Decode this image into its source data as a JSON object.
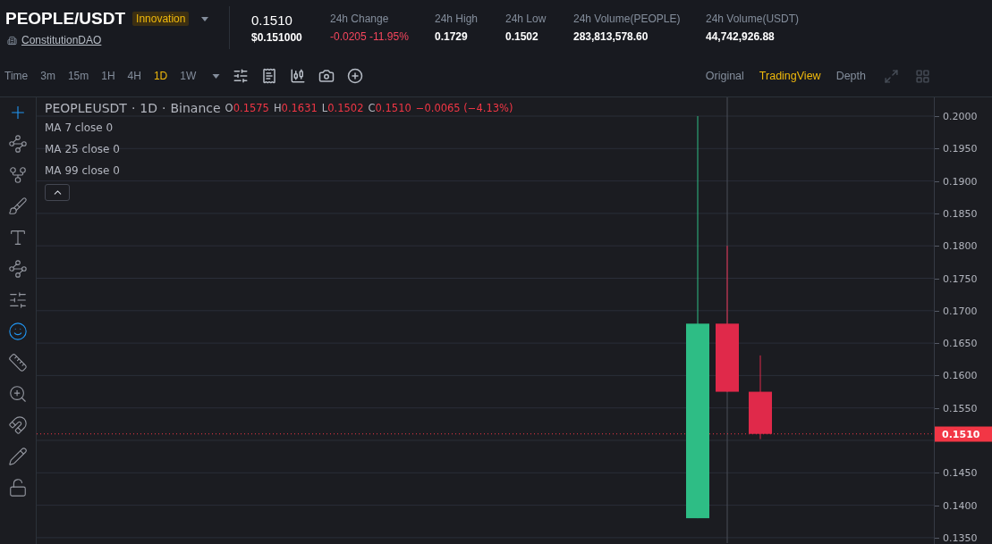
{
  "header": {
    "symbol": "PEOPLE/USDT",
    "badge": "Innovation",
    "project": "ConstitutionDAO",
    "price": "0.1510",
    "price_usd": "$0.151000",
    "stats": [
      {
        "label": "24h Change",
        "value": "-0.0205 -11.95%",
        "kind": "down"
      },
      {
        "label": "24h High",
        "value": "0.1729",
        "kind": "plain"
      },
      {
        "label": "24h Low",
        "value": "0.1502",
        "kind": "plain"
      },
      {
        "label": "24h Volume(PEOPLE)",
        "value": "283,813,578.60",
        "kind": "plain"
      },
      {
        "label": "24h Volume(USDT)",
        "value": "44,742,926.88",
        "kind": "plain"
      }
    ]
  },
  "toolbar": {
    "intervals": [
      {
        "label": "Time",
        "selected": false
      },
      {
        "label": "3m",
        "selected": false
      },
      {
        "label": "15m",
        "selected": false
      },
      {
        "label": "1H",
        "selected": false
      },
      {
        "label": "4H",
        "selected": false
      },
      {
        "label": "1D",
        "selected": true
      },
      {
        "label": "1W",
        "selected": false
      }
    ],
    "views": [
      {
        "label": "Original",
        "selected": false
      },
      {
        "label": "TradingView",
        "selected": true
      },
      {
        "label": "Depth",
        "selected": false
      }
    ]
  },
  "chart": {
    "legend": {
      "title": [
        "PEOPLEUSDT",
        "·",
        "1D",
        "·",
        "Binance"
      ],
      "ohlc": [
        {
          "label": "O",
          "value": "0.1575"
        },
        {
          "label": "H",
          "value": "0.1631"
        },
        {
          "label": "L",
          "value": "0.1502"
        },
        {
          "label": "C",
          "value": "0.1510"
        }
      ],
      "change": "−0.0065 (−4.13%)"
    },
    "indicators": [
      "MA 7 close 0",
      "MA 25 close 0",
      "MA 99 close 0"
    ],
    "price_ticks": [
      "0.2000",
      "0.1950",
      "0.1900",
      "0.1850",
      "0.1800",
      "0.1750",
      "0.1700",
      "0.1650",
      "0.1600",
      "0.1550",
      "0.1450",
      "0.1400",
      "0.1350"
    ],
    "last_price": "0.1510"
  }
}
